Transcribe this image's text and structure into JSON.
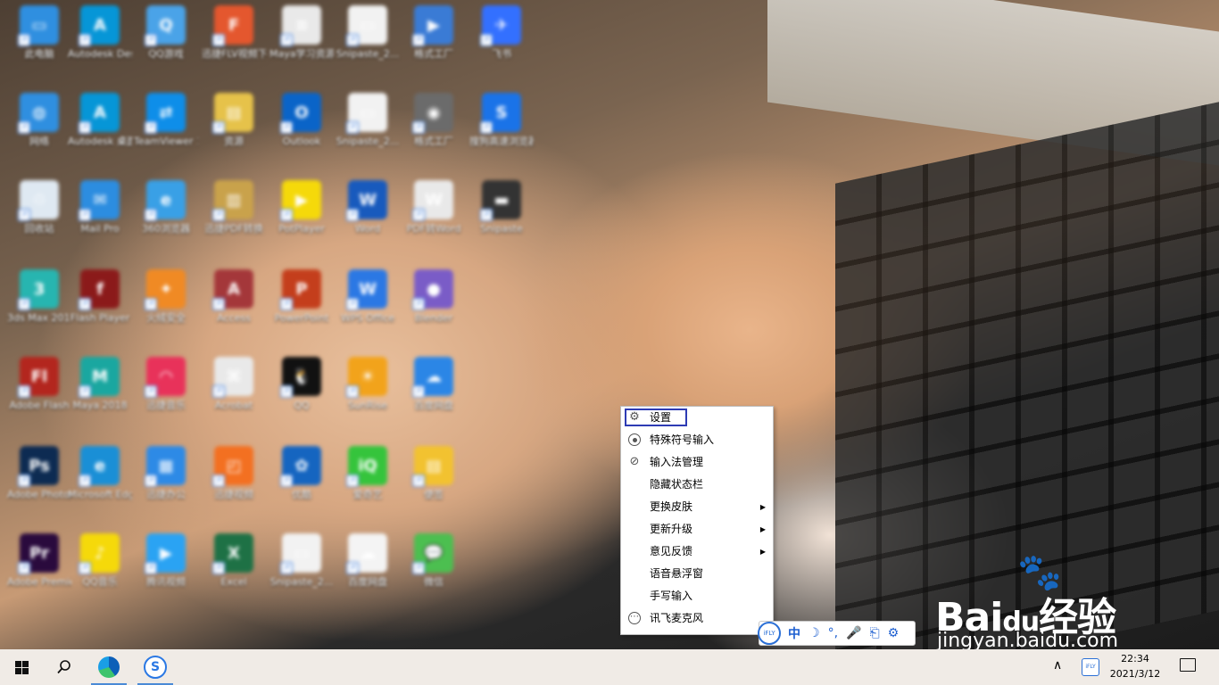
{
  "desktop": {
    "icons": [
      {
        "label": "此电脑",
        "color": "#2f8fe0",
        "glyph": "▭"
      },
      {
        "label": "Autodesk Desktop",
        "color": "#0696d7",
        "glyph": "A"
      },
      {
        "label": "QQ游戏",
        "color": "#4aa3e8",
        "glyph": "Q"
      },
      {
        "label": "迅捷FLV视频下载器",
        "color": "#e4572e",
        "glyph": "F"
      },
      {
        "label": "Maya学习资源.txt",
        "color": "#e9e9e9",
        "glyph": "≡"
      },
      {
        "label": "Snipaste_2...",
        "color": "#f2f2f2",
        "glyph": "▭"
      },
      {
        "label": "格式工厂",
        "color": "#3a7bd5",
        "glyph": "▶"
      },
      {
        "label": "飞书",
        "color": "#3370ff",
        "glyph": "✈"
      },
      {
        "label": "网络",
        "color": "#2f8fe0",
        "glyph": "◍"
      },
      {
        "label": "Autodesk 桌面应用程序",
        "color": "#0696d7",
        "glyph": "A"
      },
      {
        "label": "TeamViewer 12",
        "color": "#0e8ee9",
        "glyph": "⇄"
      },
      {
        "label": "资源",
        "color": "#e6c24a",
        "glyph": "▤"
      },
      {
        "label": "Outlook",
        "color": "#0a64c8",
        "glyph": "O"
      },
      {
        "label": "Snipaste_2...",
        "color": "#f2f2f2",
        "glyph": "▭"
      },
      {
        "label": "格式工厂",
        "color": "#6b6b6b",
        "glyph": "◉"
      },
      {
        "label": "搜狗高速浏览器",
        "color": "#1a73e8",
        "glyph": "S"
      },
      {
        "label": "回收站",
        "color": "#dfe9f2",
        "glyph": "♲"
      },
      {
        "label": "Mail Pro",
        "color": "#2c8de0",
        "glyph": "✉"
      },
      {
        "label": "360浏览器",
        "color": "#39a0e6",
        "glyph": "e"
      },
      {
        "label": "迅捷PDF转换",
        "color": "#c9a24b",
        "glyph": "▥"
      },
      {
        "label": "PotPlayer",
        "color": "#f5d90a",
        "glyph": "▶"
      },
      {
        "label": "Word",
        "color": "#185abd",
        "glyph": "W"
      },
      {
        "label": "PDF转Word",
        "color": "#e9e9e9",
        "glyph": "W"
      },
      {
        "label": "Snipaste",
        "color": "#333333",
        "glyph": "▬"
      },
      {
        "label": "3ds Max 2017",
        "color": "#27b5b0",
        "glyph": "3"
      },
      {
        "label": "Flash Player",
        "color": "#8b1a1a",
        "glyph": "f"
      },
      {
        "label": "火绒安全",
        "color": "#f08a24",
        "glyph": "✦"
      },
      {
        "label": "Access",
        "color": "#a4373a",
        "glyph": "A"
      },
      {
        "label": "PowerPoint",
        "color": "#c43e1c",
        "glyph": "P"
      },
      {
        "label": "WPS Office",
        "color": "#2b78e4",
        "glyph": "W"
      },
      {
        "label": "Blender",
        "color": "#7a5cc7",
        "glyph": "●"
      },
      {
        "label": "",
        "color": "#000000",
        "glyph": ""
      },
      {
        "label": "Adobe Flash",
        "color": "#b3261e",
        "glyph": "Fl"
      },
      {
        "label": "Maya 2018",
        "color": "#1aa7a0",
        "glyph": "M"
      },
      {
        "label": "迅捷音乐",
        "color": "#e8325a",
        "glyph": "◠"
      },
      {
        "label": "Acrobat",
        "color": "#e9e9e9",
        "glyph": "⌘"
      },
      {
        "label": "QQ",
        "color": "#111111",
        "glyph": "🐧"
      },
      {
        "label": "SunRise",
        "color": "#f2a31b",
        "glyph": "☀"
      },
      {
        "label": "百度网盘",
        "color": "#2b86e6",
        "glyph": "☁"
      },
      {
        "label": "",
        "color": "#000000",
        "glyph": ""
      },
      {
        "label": "Adobe Photoshop",
        "color": "#0d2b52",
        "glyph": "Ps"
      },
      {
        "label": "Microsoft Edge",
        "color": "#1a8fd6",
        "glyph": "e"
      },
      {
        "label": "迅捷办公",
        "color": "#2d8ae6",
        "glyph": "▦"
      },
      {
        "label": "迅捷视频",
        "color": "#f37021",
        "glyph": "◰"
      },
      {
        "label": "优酷",
        "color": "#1565c0",
        "glyph": "✿"
      },
      {
        "label": "爱奇艺",
        "color": "#35c43c",
        "glyph": "iQ"
      },
      {
        "label": "便签",
        "color": "#f2c230",
        "glyph": "▤"
      },
      {
        "label": "",
        "color": "#000000",
        "glyph": ""
      },
      {
        "label": "Adobe Premiere",
        "color": "#2a0a3d",
        "glyph": "Pr"
      },
      {
        "label": "QQ音乐",
        "color": "#f5d90a",
        "glyph": "♪"
      },
      {
        "label": "腾讯视频",
        "color": "#2aa3f3",
        "glyph": "▶"
      },
      {
        "label": "Excel",
        "color": "#1e7145",
        "glyph": "X"
      },
      {
        "label": "Snipaste_2...",
        "color": "#f2f2f2",
        "glyph": "▭"
      },
      {
        "label": "百度网盘",
        "color": "#f4f4f4",
        "glyph": "☁"
      },
      {
        "label": "微信",
        "color": "#4cbf50",
        "glyph": "💬"
      }
    ]
  },
  "context_menu": {
    "items": [
      {
        "label": "设置",
        "icon": "gear-icon",
        "highlighted": true,
        "submenu": false
      },
      {
        "label": "特殊符号输入",
        "icon": "target-icon",
        "highlighted": false,
        "submenu": false
      },
      {
        "label": "输入法管理",
        "icon": "link-icon",
        "highlighted": false,
        "submenu": false
      },
      {
        "label": "隐藏状态栏",
        "icon": "",
        "highlighted": false,
        "submenu": false
      },
      {
        "label": "更换皮肤",
        "icon": "",
        "highlighted": false,
        "submenu": true
      },
      {
        "label": "更新升级",
        "icon": "",
        "highlighted": false,
        "submenu": true
      },
      {
        "label": "意见反馈",
        "icon": "",
        "highlighted": false,
        "submenu": true
      },
      {
        "label": "语音悬浮窗",
        "icon": "",
        "highlighted": false,
        "submenu": false
      },
      {
        "label": "手写输入",
        "icon": "",
        "highlighted": false,
        "submenu": false
      },
      {
        "label": "讯飞麦克风",
        "icon": "more-icon",
        "highlighted": false,
        "submenu": false
      }
    ],
    "highlight_color": "#2d3bb4"
  },
  "ime_toolbar": {
    "logo": "iFLY",
    "mode": "中",
    "glyphs": [
      "☽",
      "°,",
      "🎤",
      "⎗",
      "⚙"
    ],
    "accent": "#1d5fd0"
  },
  "watermark": {
    "brand_a": "Bai",
    "brand_du": "du",
    "brand_b": "经验",
    "url": "jingyan.baidu.com"
  },
  "taskbar": {
    "time": "22:34",
    "date": "2021/3/12",
    "tray_ime": "iFLY"
  }
}
